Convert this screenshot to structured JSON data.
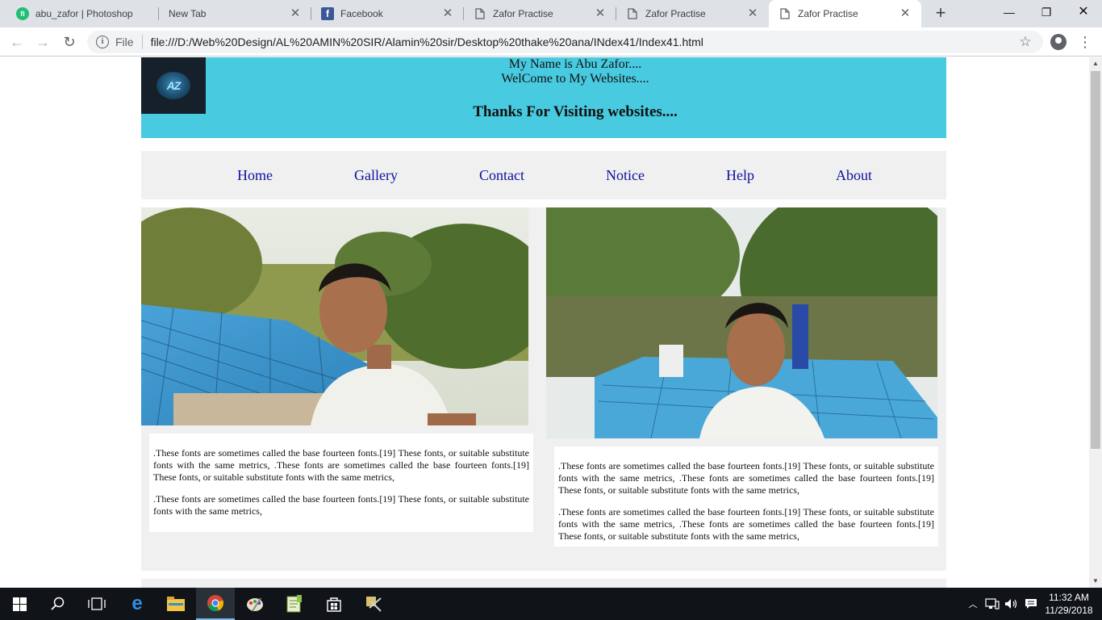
{
  "browser": {
    "tabs": [
      {
        "title": "abu_zafor | Photoshop",
        "favicon": "fiverr-icon",
        "active": false
      },
      {
        "title": "New Tab",
        "favicon": "none",
        "active": false
      },
      {
        "title": "Facebook",
        "favicon": "facebook-icon",
        "active": false
      },
      {
        "title": "Zafor Practise",
        "favicon": "page-icon",
        "active": false
      },
      {
        "title": "Zafor Practise",
        "favicon": "page-icon",
        "active": false
      },
      {
        "title": "Zafor Practise",
        "favicon": "page-icon",
        "active": true
      }
    ],
    "address": {
      "scheme_label": "File",
      "url": "file:///D:/Web%20Design/AL%20AMIN%20SIR/Alamin%20sir/Desktop%20thake%20ana/INdex41/Index41.html"
    }
  },
  "page": {
    "logo_text": "AZ",
    "header": {
      "line1": "My Name is Abu Zafor....",
      "line2": "WelCome to My Websites....",
      "thanks": "Thanks For Visiting websites...."
    },
    "nav": [
      "Home",
      "Gallery",
      "Contact",
      "Notice",
      "Help",
      "About"
    ],
    "left_card": {
      "paragraph1": ".These fonts are sometimes called the base fourteen fonts.[19] These fonts, or suitable substitute fonts with the same metrics, .These fonts are sometimes called the base fourteen fonts.[19] These fonts, or suitable substitute fonts with the same metrics,",
      "paragraph2": ".These fonts are sometimes called the base fourteen fonts.[19] These fonts, or suitable substitute fonts with the same metrics,"
    },
    "right_card": {
      "paragraph1": ".These fonts are sometimes called the base fourteen fonts.[19] These fonts, or suitable substitute fonts with the same metrics, .These fonts are sometimes called the base fourteen fonts.[19] These fonts, or suitable substitute fonts with the same metrics,",
      "paragraph2": ".These fonts are sometimes called the base fourteen fonts.[19] These fonts, or suitable substitute fonts with the same metrics, .These fonts are sometimes called the base fourteen fonts.[19] These fonts, or suitable substitute fonts with the same metrics,"
    },
    "colors": {
      "header_bg": "#48cae0",
      "nav_bg": "#f0f0f0",
      "link": "#1010a0"
    }
  },
  "taskbar": {
    "pinned": [
      "windows-start-icon",
      "search-icon",
      "task-view-icon",
      "edge-icon",
      "file-explorer-icon",
      "chrome-icon",
      "paint-icon",
      "notepad-plus-icon",
      "store-icon",
      "tool-icon"
    ],
    "clock": {
      "time": "11:32 AM",
      "date": "11/29/2018"
    }
  }
}
